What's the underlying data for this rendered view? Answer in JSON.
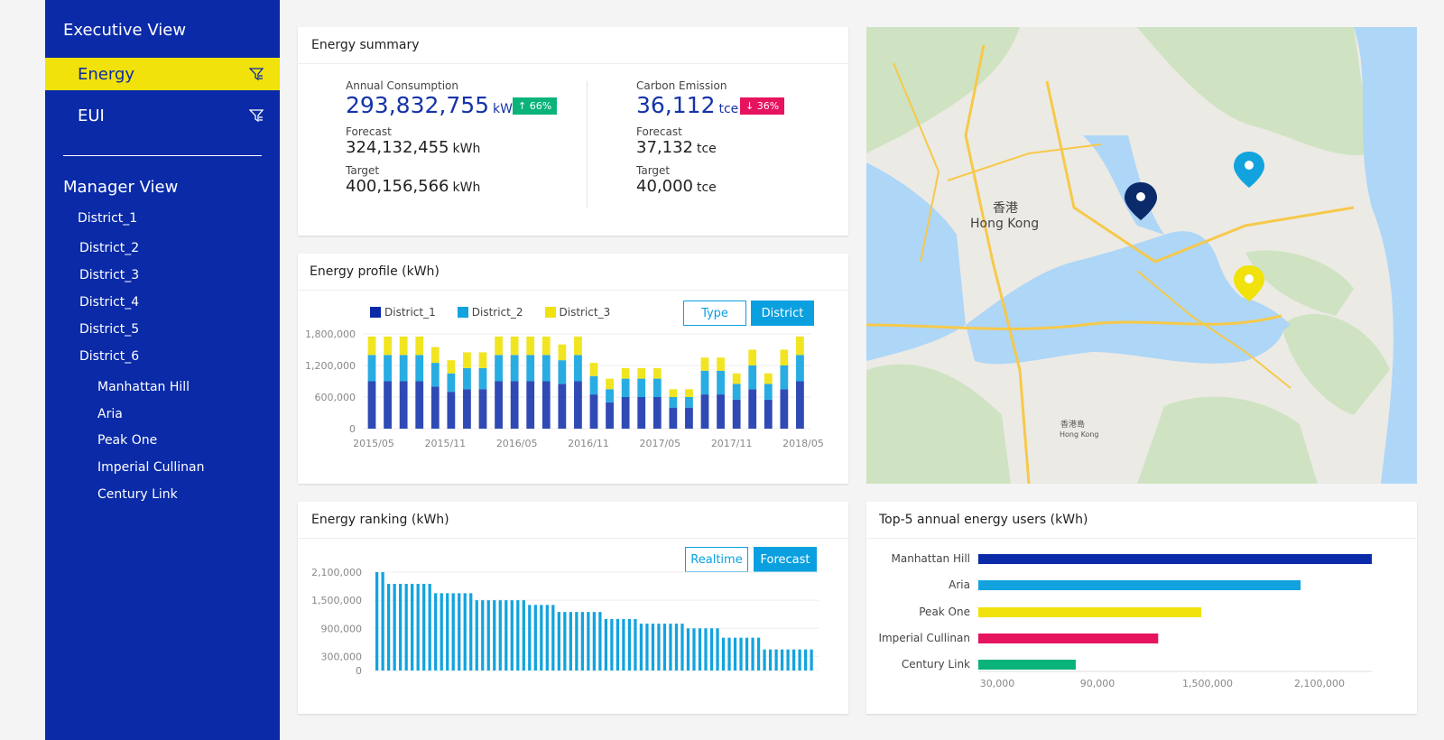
{
  "sidebar": {
    "executive_title": "Executive View",
    "energy_label": "Energy",
    "eui_label": "EUI",
    "manager_title": "Manager View",
    "districts": [
      "District_1",
      "District_2",
      "District_3",
      "District_4",
      "District_5",
      "District_6"
    ],
    "buildings": [
      "Manhattan Hill",
      "Aria",
      "Peak One",
      "Imperial Cullinan",
      "Century Link"
    ]
  },
  "summary": {
    "title": "Energy summary",
    "annual": {
      "label": "Annual Consumption",
      "value": "293,832,755",
      "unit": "kWh",
      "badge": "↑ 66%"
    },
    "annual_forecast": {
      "label": "Forecast",
      "value": "324,132,455",
      "unit": "kWh"
    },
    "annual_target": {
      "label": "Target",
      "value": "400,156,566",
      "unit": "kWh"
    },
    "carbon": {
      "label": "Carbon Emission",
      "value": "36,112",
      "unit": "tce",
      "badge": "↓ 36%"
    },
    "carbon_forecast": {
      "label": "Forecast",
      "value": "37,132",
      "unit": "tce"
    },
    "carbon_target": {
      "label": "Target",
      "value": "40,000",
      "unit": "tce"
    }
  },
  "profile": {
    "title": "Energy profile (kWh)",
    "type_button": "Type",
    "district_button": "District"
  },
  "ranking": {
    "title": "Energy ranking (kWh)",
    "realtime_button": "Realtime",
    "forecast_button": "Forecast"
  },
  "top5": {
    "title": "Top-5 annual energy users (kWh)"
  },
  "colors": {
    "d1": "#0a2aa8",
    "d2": "#12a3df",
    "d3": "#f0e20a",
    "pink": "#e6135f",
    "green": "#0ab37a"
  },
  "chart_data": [
    {
      "type": "bar",
      "stacked": true,
      "title": "Energy profile (kWh)",
      "x_tick_labels": [
        "2015/05",
        "2015/11",
        "2016/05",
        "2016/11",
        "2017/05",
        "2017/11",
        "2018/05"
      ],
      "y_tick_labels": [
        "0",
        "600,000",
        "1,200,000",
        "1,800,000"
      ],
      "ylim": [
        0,
        1800000
      ],
      "legend": "top",
      "series": [
        {
          "name": "District_1",
          "values": [
            900000,
            900000,
            900000,
            900000,
            800000,
            700000,
            750000,
            750000,
            900000,
            900000,
            900000,
            900000,
            850000,
            900000,
            650000,
            500000,
            600000,
            600000,
            600000,
            400000,
            400000,
            650000,
            650000,
            550000,
            750000,
            550000,
            750000,
            900000
          ]
        },
        {
          "name": "District_2",
          "values": [
            500000,
            500000,
            500000,
            500000,
            450000,
            350000,
            400000,
            400000,
            500000,
            500000,
            500000,
            500000,
            450000,
            500000,
            350000,
            250000,
            350000,
            350000,
            350000,
            200000,
            200000,
            450000,
            450000,
            300000,
            450000,
            300000,
            450000,
            500000
          ]
        },
        {
          "name": "District_3",
          "values": [
            350000,
            350000,
            350000,
            350000,
            300000,
            250000,
            300000,
            300000,
            350000,
            350000,
            350000,
            350000,
            300000,
            350000,
            250000,
            200000,
            200000,
            200000,
            200000,
            150000,
            150000,
            250000,
            250000,
            200000,
            300000,
            200000,
            300000,
            350000
          ]
        }
      ]
    },
    {
      "type": "bar",
      "title": "Energy ranking (kWh)",
      "y_tick_labels": [
        "0",
        "300,000",
        "900,000",
        "1,500,000",
        "2,100,000"
      ],
      "y_tick_values": [
        0,
        300000,
        900000,
        1500000,
        2100000
      ],
      "values": [
        2100000,
        2100000,
        1850000,
        1850000,
        1850000,
        1850000,
        1850000,
        1850000,
        1850000,
        1850000,
        1650000,
        1650000,
        1650000,
        1650000,
        1650000,
        1650000,
        1650000,
        1500000,
        1500000,
        1500000,
        1500000,
        1500000,
        1500000,
        1500000,
        1500000,
        1500000,
        1400000,
        1400000,
        1400000,
        1400000,
        1400000,
        1250000,
        1250000,
        1250000,
        1250000,
        1250000,
        1250000,
        1250000,
        1250000,
        1100000,
        1100000,
        1100000,
        1100000,
        1100000,
        1100000,
        1000000,
        1000000,
        1000000,
        1000000,
        1000000,
        1000000,
        1000000,
        1000000,
        900000,
        900000,
        900000,
        900000,
        900000,
        900000,
        700000,
        700000,
        700000,
        700000,
        700000,
        700000,
        700000,
        450000,
        450000,
        450000,
        450000,
        450000,
        450000,
        450000,
        450000,
        450000
      ]
    },
    {
      "type": "bar",
      "orientation": "horizontal",
      "title": "Top-5 annual energy users (kWh)",
      "categories": [
        "Manhattan Hill",
        "Aria",
        "Peak One",
        "Imperial Cullinan",
        "Century Link"
      ],
      "x_tick_labels": [
        "30,000",
        "90,000",
        "1,500,000",
        "2,100,000"
      ],
      "values": [
        2100000,
        1720000,
        1190000,
        960000,
        520000
      ],
      "colors": [
        "#0a2aa8",
        "#12a3df",
        "#f0e20a",
        "#e6135f",
        "#0ab37a"
      ]
    }
  ]
}
